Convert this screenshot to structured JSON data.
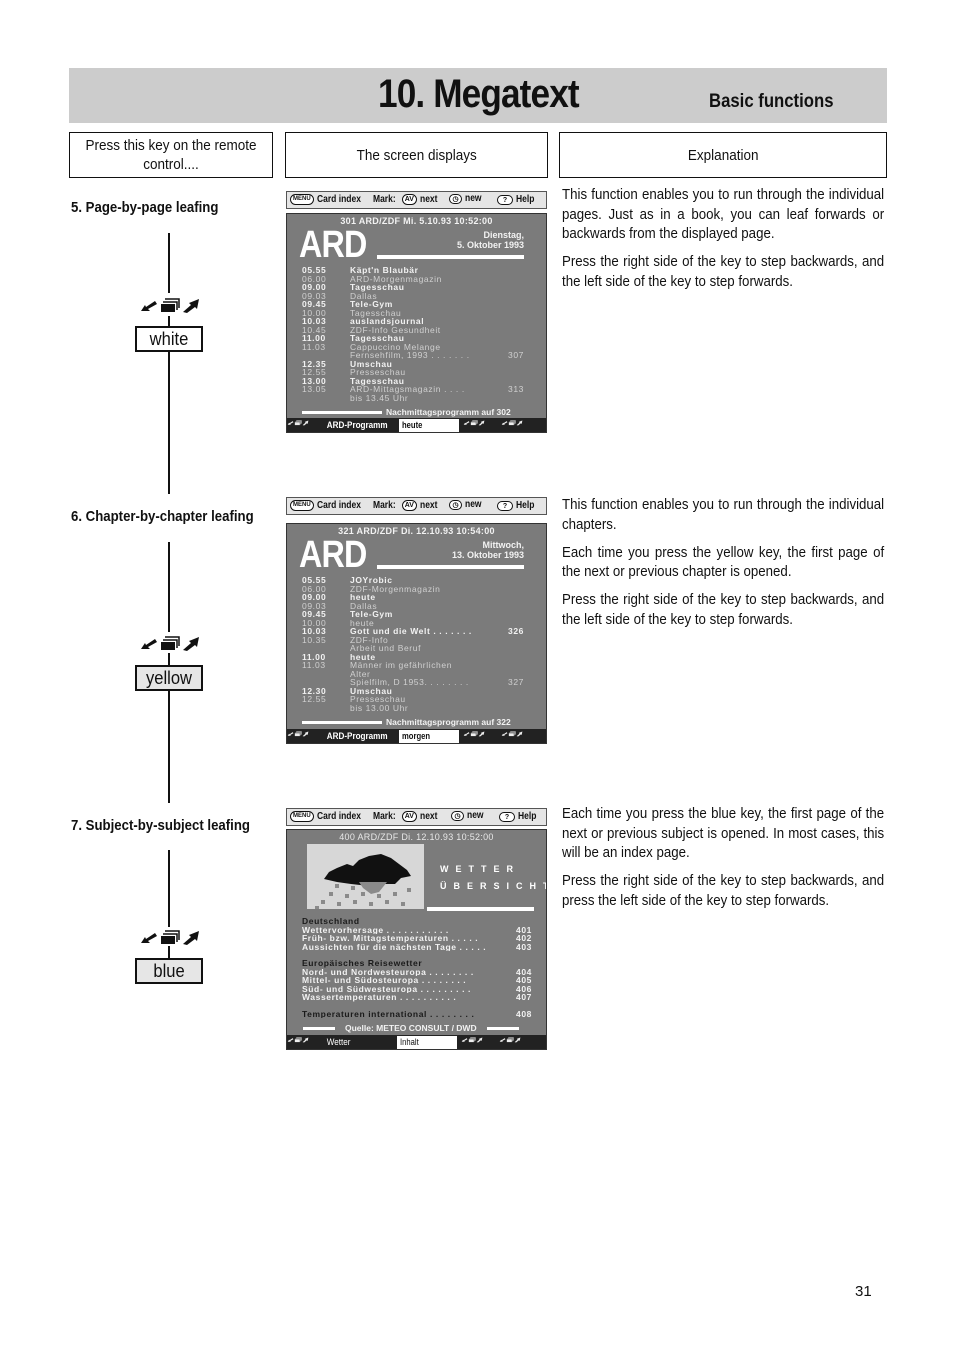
{
  "header": {
    "title": "10. Megatext",
    "subtitle": "Basic functions"
  },
  "columns": {
    "key": "Press this key on the remote control....",
    "screen": "The screen displays",
    "explanation": "Explanation"
  },
  "menubar": {
    "menu_key": "MENU",
    "card_index": "Card index",
    "mark_label": "Mark:",
    "av_key": "AV",
    "next": "next",
    "new": "new",
    "help_key": "?",
    "help": "Help"
  },
  "sections": [
    {
      "title": "5. Page-by-page leafing",
      "key_label": "white",
      "screen": {
        "header": "301  ARD/ZDF  Mi.  5.10.93  10:52:00",
        "logo": "ARD",
        "date_line1": "Dienstag,",
        "date_line2": "5. Oktober 1993",
        "programme": [
          {
            "time": "05.55",
            "name": "Käpt'n Blaubär",
            "page": "",
            "bright": true
          },
          {
            "time": "06.00",
            "name": "ARD-Morgenmagazin",
            "page": "",
            "bright": false
          },
          {
            "time": "09.00",
            "name": "Tagesschau",
            "page": "",
            "bright": true
          },
          {
            "time": "09.03",
            "name": "Dallas",
            "page": "",
            "bright": false
          },
          {
            "time": "09.45",
            "name": "Tele-Gym",
            "page": "",
            "bright": true
          },
          {
            "time": "10.00",
            "name": "Tagesschau",
            "page": "",
            "bright": false
          },
          {
            "time": "10.03",
            "name": "auslandsjournal",
            "page": "",
            "bright": true
          },
          {
            "time": "10.45",
            "name": "ZDF-Info Gesundheit",
            "page": "",
            "bright": false
          },
          {
            "time": "11.00",
            "name": "Tagesschau",
            "page": "",
            "bright": true
          },
          {
            "time": "11.03",
            "name": "Cappuccino Melange",
            "page": "",
            "bright": false
          },
          {
            "time": "",
            "name": "Fernsehfilm, 1993 . . . . . . .",
            "page": "307",
            "bright": false
          },
          {
            "time": "12.35",
            "name": "Umschau",
            "page": "",
            "bright": true
          },
          {
            "time": "12.55",
            "name": "Presseschau",
            "page": "",
            "bright": false
          },
          {
            "time": "13.00",
            "name": "Tagesschau",
            "page": "",
            "bright": true
          },
          {
            "time": "13.05",
            "name": "ARD-Mittagsmagazin . . . .",
            "page": "313",
            "bright": false
          },
          {
            "time": "",
            "name": "bis 13.45 Uhr",
            "page": "",
            "bright": false
          }
        ],
        "footer": "Nachmittagsprogramm auf 302",
        "bottom_label": "ARD-Programm",
        "bottom_field": "heute"
      },
      "explanation": [
        "This function enables you to run through the individual pages. Just as in a book, you can leaf forwards or backwards from the displayed page.",
        "Press the right side of the key to step backwards, and the left side of the key to step forwards."
      ]
    },
    {
      "title": "6. Chapter-by-chapter leafing",
      "key_label": "yellow",
      "screen": {
        "header": "321  ARD/ZDF  Di.  12.10.93  10:54:00",
        "logo": "ARD",
        "date_line1": "Mittwoch,",
        "date_line2": "13. Oktober 1993",
        "programme": [
          {
            "time": "05.55",
            "name": "JOYrobic",
            "page": "",
            "bright": true
          },
          {
            "time": "06.00",
            "name": "ZDF-Morgenmagazin",
            "page": "",
            "bright": false
          },
          {
            "time": "09.00",
            "name": "heute",
            "page": "",
            "bright": true
          },
          {
            "time": "09.03",
            "name": "Dallas",
            "page": "",
            "bright": false
          },
          {
            "time": "09.45",
            "name": "Tele-Gym",
            "page": "",
            "bright": true
          },
          {
            "time": "10.00",
            "name": "heute",
            "page": "",
            "bright": false
          },
          {
            "time": "10.03",
            "name": "Gott und die Welt  . . . . . . .",
            "page": "326",
            "bright": true
          },
          {
            "time": "10.35",
            "name": "ZDF-Info",
            "page": "",
            "bright": false
          },
          {
            "time": "",
            "name": "Arbeit und Beruf",
            "page": "",
            "bright": false
          },
          {
            "time": "11.00",
            "name": "heute",
            "page": "",
            "bright": true
          },
          {
            "time": "11.03",
            "name": "Männer im gefährlichen",
            "page": "",
            "bright": false
          },
          {
            "time": "",
            "name": "Alter",
            "page": "",
            "bright": false
          },
          {
            "time": "",
            "name": "Spielfilm, D 1953. . . . . . . .",
            "page": "327",
            "bright": false
          },
          {
            "time": "12.30",
            "name": "Umschau",
            "page": "",
            "bright": true
          },
          {
            "time": "12.55",
            "name": "Presseschau",
            "page": "",
            "bright": false
          },
          {
            "time": "",
            "name": "bis 13.00 Uhr",
            "page": "",
            "bright": false
          }
        ],
        "footer": "Nachmittagsprogramm auf 322",
        "bottom_label": "ARD-Programm",
        "bottom_field": "morgen"
      },
      "explanation": [
        "This function enables you to run through the individual chapters.",
        "Each time you press the yellow key, the first page of the next or previous chapter is opened.",
        "Press the right side of the key to step backwards, and the left side of the key to step forwards."
      ]
    },
    {
      "title": "7. Subject-by-subject leafing",
      "key_label": "blue",
      "screen": {
        "header": "400  ARD/ZDF  Di.   12.10.93  10:52:00",
        "title_line1": "WETTER",
        "title_line2": "ÜBERSICHT",
        "groups": [
          {
            "heading": "Deutschland",
            "items": [
              {
                "name": "Wettervorhersage  . . . . . . . . . . .",
                "page": "401"
              },
              {
                "name": "Früh- bzw. Mittagstemperaturen   . . . . .",
                "page": "402"
              },
              {
                "name": "Aussichten für die nächsten Tage  . . . . .",
                "page": "403"
              }
            ]
          },
          {
            "heading": "Europäisches Reisewetter",
            "items": [
              {
                "name": "Nord- und Nordwesteuropa  . . . . . . . .",
                "page": "404"
              },
              {
                "name": "Mittel- und Südosteuropa  . . . . . . . .",
                "page": "405"
              },
              {
                "name": "Süd- und Südwesteuropa  . . . . . . . . .",
                "page": "406"
              },
              {
                "name": "Wassertemperaturen  . . . . . . . . . .",
                "page": "407"
              }
            ]
          }
        ],
        "intl": {
          "name": "Temperaturen international  . . . . . . . .",
          "page": "408"
        },
        "footer": "Quelle: METEO CONSULT / DWD",
        "bottom_label": "Wetter",
        "bottom_field": "Inhalt"
      },
      "explanation": [
        "Each time you press the blue key, the first page of the next or previous subject is opened. In most cases,  this will be an index page.",
        "Press the right side of the key to step backwards, and press the left side of the key to step forwards."
      ]
    }
  ],
  "page_number": "31"
}
